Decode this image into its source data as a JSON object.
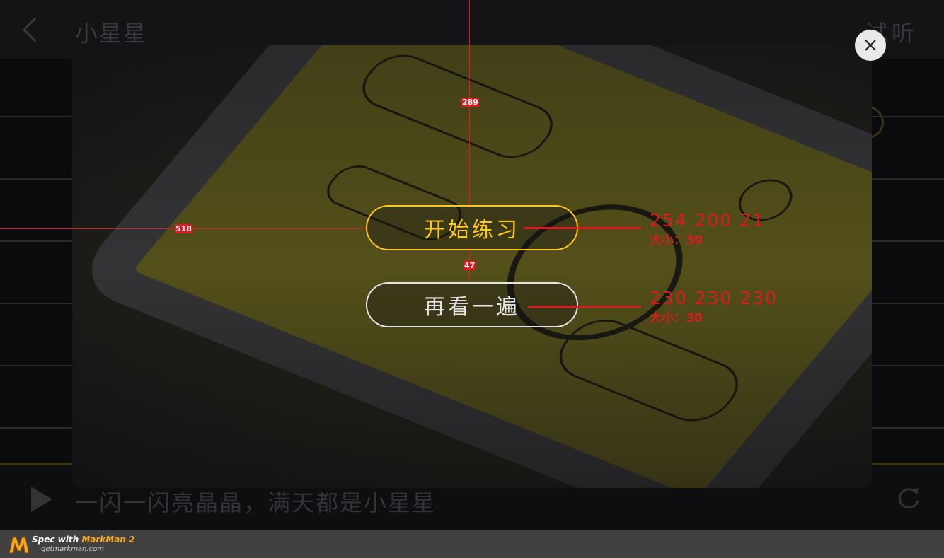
{
  "header": {
    "title": "小星星",
    "listen_label": "试听"
  },
  "lyrics": {
    "line": "一闪一闪亮晶晶，满天都是小星星"
  },
  "modal": {
    "start_label": "开始练习",
    "replay_label": "再看一遍",
    "close_icon": "close-icon"
  },
  "annotations": {
    "top_gap": "289",
    "left_gap": "518",
    "button_gap": "47",
    "start_color": "254 200 21",
    "start_size": "大小：30",
    "replay_color": "230 230 230",
    "replay_size": "大小：30"
  },
  "footer": {
    "brand_prefix": "Spec with ",
    "brand_name": "MarkMan 2",
    "url": "getmarkman.com"
  },
  "colors": {
    "start_button": "#FEC815",
    "replay_button": "#E6E6E6",
    "annotation": "#E0191F",
    "footer_bg": "#414141"
  }
}
